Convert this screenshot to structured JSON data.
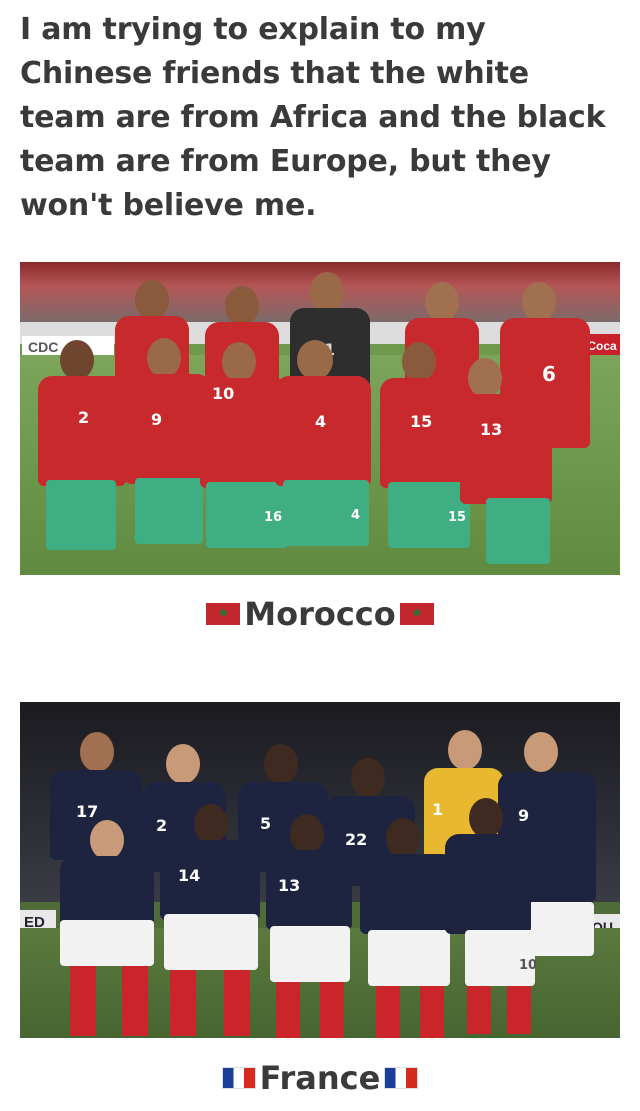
{
  "caption": "I am trying to explain to my Chinese friends that the white team are from Africa and the black team are from Europe, but they won't believe me.",
  "morocco": {
    "label": "Morocco",
    "flag_icon": "morocco-flag-icon",
    "board_left": "CDC",
    "board_right": "Coca",
    "numbers": [
      "2",
      "9",
      "10",
      "4",
      "15",
      "13",
      "10",
      "1",
      "6",
      "16",
      "4",
      "15"
    ],
    "colors": {
      "shirt": "#c8292d",
      "shorts": "#3fae82",
      "keeper": "#2e2e2e"
    }
  },
  "france": {
    "label": "France",
    "flag_icon": "france-flag-icon",
    "board_left": "ED",
    "board_right": "QU",
    "numbers": [
      "17",
      "2",
      "5",
      "22",
      "9",
      "14",
      "13",
      "1",
      "10"
    ],
    "colors": {
      "shirt": "#1e2440",
      "shorts": "#f2f2f2",
      "keeper": "#e8b830",
      "socks": "#c9252b"
    }
  }
}
